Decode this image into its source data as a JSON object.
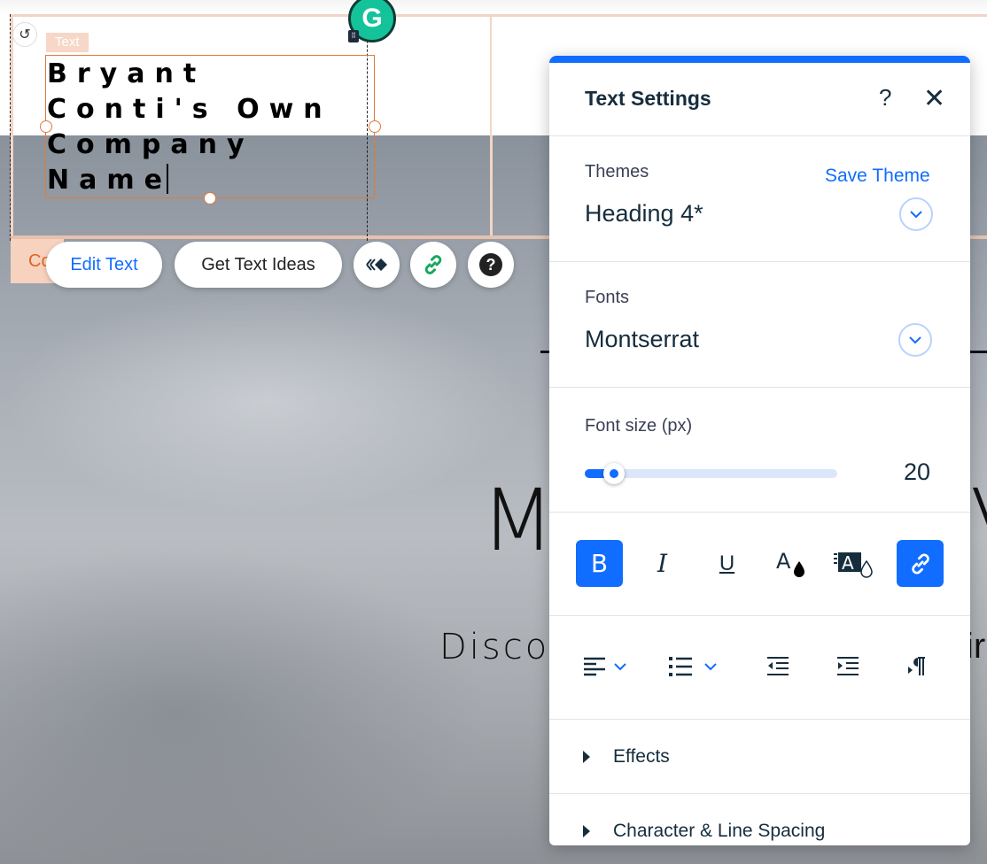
{
  "canvas": {
    "element_tag": "Text",
    "company_lines": [
      "Bryant",
      "Conti's Own",
      "Company",
      "Name"
    ],
    "hero_big_text": "M",
    "hero_big_text_right": "V",
    "hero_sub_text": "Discov",
    "hero_sub_text_right": "ir",
    "orange_tab_label": "Co"
  },
  "grammarly": {
    "letter": "G"
  },
  "action_bar": {
    "edit_text": "Edit Text",
    "get_text_ideas": "Get Text Ideas",
    "help_glyph": "?"
  },
  "panel": {
    "title": "Text Settings",
    "help": "?",
    "close": "✕",
    "themes": {
      "label": "Themes",
      "save_theme": "Save Theme",
      "value": "Heading 4*"
    },
    "fonts": {
      "label": "Fonts",
      "value": "Montserrat"
    },
    "font_size": {
      "label": "Font size (px)",
      "value": "20",
      "slider_fraction": 0.115
    },
    "format_buttons": [
      {
        "name": "bold",
        "glyph": "B",
        "active": true
      },
      {
        "name": "italic",
        "glyph": "I",
        "active": false
      },
      {
        "name": "underline",
        "glyph": "U",
        "active": false
      },
      {
        "name": "text-color",
        "glyph": "A",
        "active": false
      },
      {
        "name": "highlight",
        "glyph": "A",
        "active": false
      },
      {
        "name": "link",
        "glyph": "link",
        "active": true
      }
    ],
    "sections": [
      {
        "label": "Effects"
      },
      {
        "label": "Character & Line Spacing"
      }
    ]
  },
  "colors": {
    "accent": "#116dff",
    "grammarly": "#15c39a",
    "selection": "#e07a3c"
  }
}
